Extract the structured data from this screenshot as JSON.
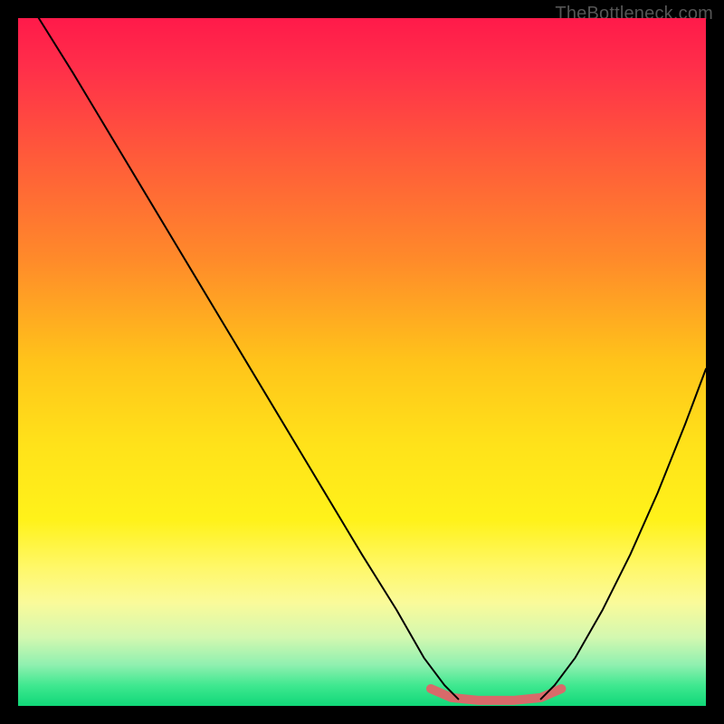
{
  "watermark": "TheBottleneck.com",
  "chart_data": {
    "type": "line",
    "title": "",
    "xlabel": "",
    "ylabel": "",
    "xlim": [
      0,
      100
    ],
    "ylim": [
      0,
      100
    ],
    "background_gradient_stops": [
      {
        "offset": 0.0,
        "color": "#ff1a4a"
      },
      {
        "offset": 0.07,
        "color": "#ff2e4a"
      },
      {
        "offset": 0.2,
        "color": "#ff5a3a"
      },
      {
        "offset": 0.35,
        "color": "#ff8a2a"
      },
      {
        "offset": 0.5,
        "color": "#ffc41a"
      },
      {
        "offset": 0.62,
        "color": "#ffe21a"
      },
      {
        "offset": 0.73,
        "color": "#fff21a"
      },
      {
        "offset": 0.8,
        "color": "#fff86a"
      },
      {
        "offset": 0.85,
        "color": "#fafa9a"
      },
      {
        "offset": 0.9,
        "color": "#d4f8b0"
      },
      {
        "offset": 0.94,
        "color": "#90f0b0"
      },
      {
        "offset": 0.97,
        "color": "#40e890"
      },
      {
        "offset": 1.0,
        "color": "#10d878"
      }
    ],
    "series": [
      {
        "name": "curve-left",
        "stroke": "#000000",
        "stroke_width": 2,
        "points": [
          {
            "x": 3,
            "y": 100
          },
          {
            "x": 8,
            "y": 92
          },
          {
            "x": 14,
            "y": 82
          },
          {
            "x": 20,
            "y": 72
          },
          {
            "x": 26,
            "y": 62
          },
          {
            "x": 32,
            "y": 52
          },
          {
            "x": 38,
            "y": 42
          },
          {
            "x": 44,
            "y": 32
          },
          {
            "x": 50,
            "y": 22
          },
          {
            "x": 55,
            "y": 14
          },
          {
            "x": 59,
            "y": 7
          },
          {
            "x": 62,
            "y": 3
          },
          {
            "x": 64,
            "y": 1
          }
        ]
      },
      {
        "name": "curve-right",
        "stroke": "#000000",
        "stroke_width": 2,
        "points": [
          {
            "x": 76,
            "y": 1
          },
          {
            "x": 78,
            "y": 3
          },
          {
            "x": 81,
            "y": 7
          },
          {
            "x": 85,
            "y": 14
          },
          {
            "x": 89,
            "y": 22
          },
          {
            "x": 93,
            "y": 31
          },
          {
            "x": 97,
            "y": 41
          },
          {
            "x": 100,
            "y": 49
          }
        ]
      },
      {
        "name": "bottom-flat",
        "stroke": "#d86a6a",
        "stroke_width": 10,
        "points": [
          {
            "x": 60,
            "y": 2.5
          },
          {
            "x": 63,
            "y": 1.2
          },
          {
            "x": 67,
            "y": 0.8
          },
          {
            "x": 72,
            "y": 0.8
          },
          {
            "x": 76,
            "y": 1.2
          },
          {
            "x": 79,
            "y": 2.5
          }
        ]
      }
    ]
  }
}
